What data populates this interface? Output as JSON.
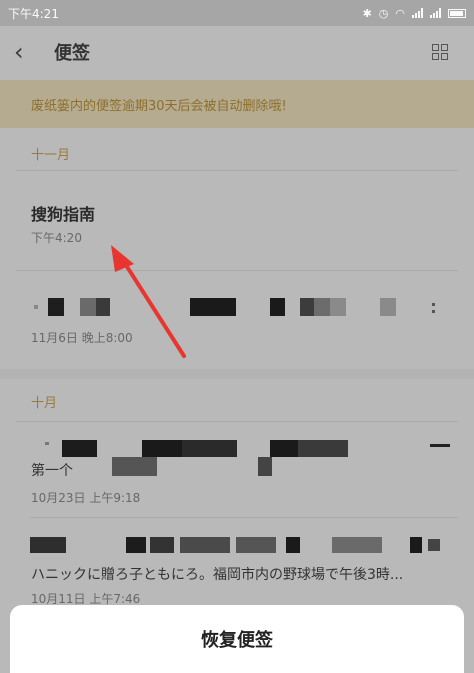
{
  "status_bar": {
    "time": "下午4:21",
    "icons": [
      "bluetooth-icon",
      "alarm-icon",
      "wifi-icon",
      "signal-icon",
      "signal-icon",
      "battery-icon"
    ]
  },
  "header": {
    "back_icon": "chevron-left-icon",
    "title": "便签",
    "view_toggle_icon": "grid-icon"
  },
  "banner": {
    "text": "废纸篓内的便签逾期30天后会被自动删除哦!",
    "color": "#b5ab91"
  },
  "sections": [
    {
      "label": "十一月",
      "notes": [
        {
          "title": "搜狗指南",
          "time": "下午4:20"
        },
        {
          "title": "",
          "time": "11月6日  晚上8:00"
        }
      ]
    },
    {
      "label": "十月",
      "notes": [
        {
          "body": "第一个",
          "time": "10月23日  上午9:18"
        },
        {
          "body": "ハニックに贈ろ子ともにろ。福岡市内の野球場で午後3時...",
          "time": "10月11日  上午7:46"
        }
      ]
    }
  ],
  "annotation": {
    "arrow_color": "#e8352f"
  },
  "bottom_sheet": {
    "action_label": "恢复便签"
  }
}
